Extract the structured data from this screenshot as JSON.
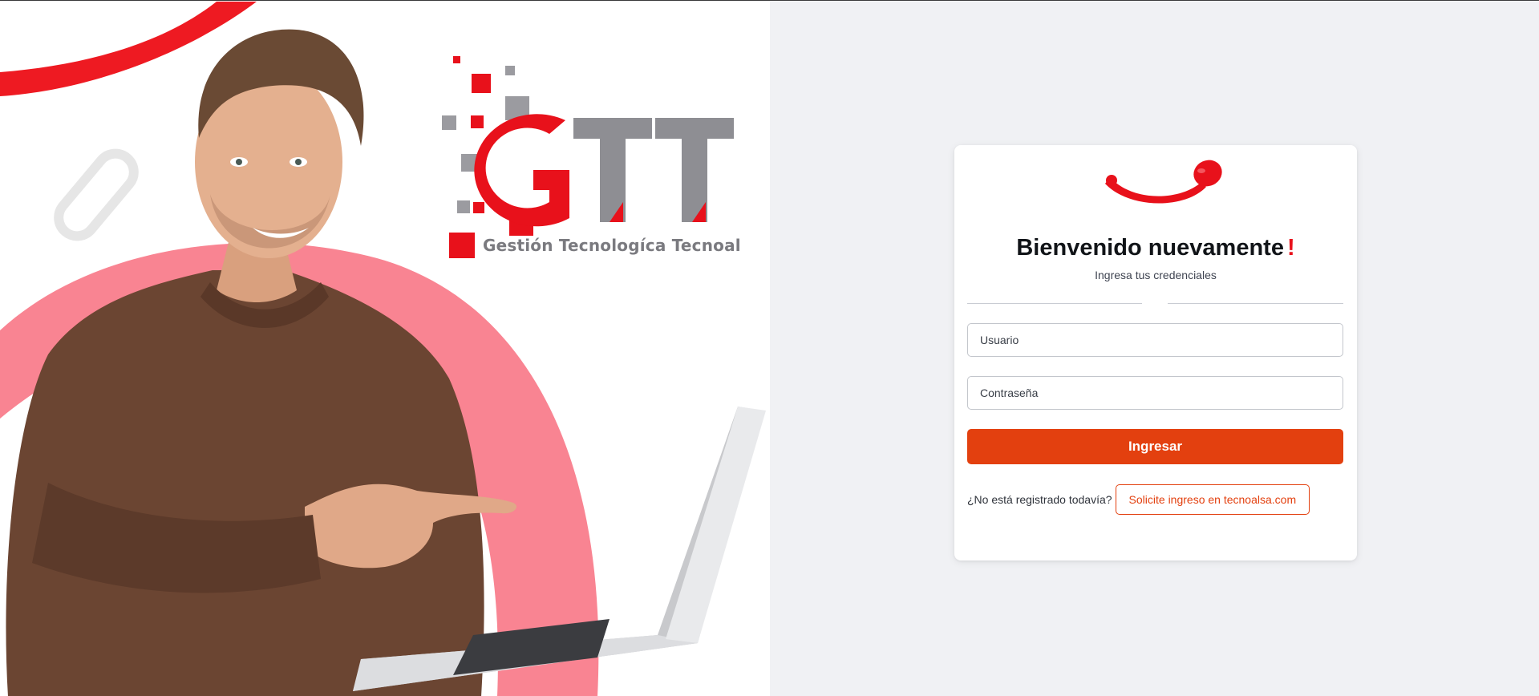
{
  "colors": {
    "brand_red": "#e8111b",
    "accent_orange": "#e3400f",
    "panel_bg": "#f0f1f4",
    "logo_gray": "#8e8e93",
    "decor_pink": "#f98492"
  },
  "hero": {
    "logo_text": "GTT",
    "tagline": "Gestión Tecnologíca Tecnoal"
  },
  "login": {
    "title": "Bienvenido nuevamente",
    "title_mark": "!",
    "subtitle": "Ingresa tus credenciales",
    "username_placeholder": "Usuario",
    "password_placeholder": "Contraseña",
    "submit_label": "Ingresar",
    "register_prompt": "¿No está registrado todavía?",
    "register_link": "Solicite ingreso en tecnoalsa.com"
  }
}
